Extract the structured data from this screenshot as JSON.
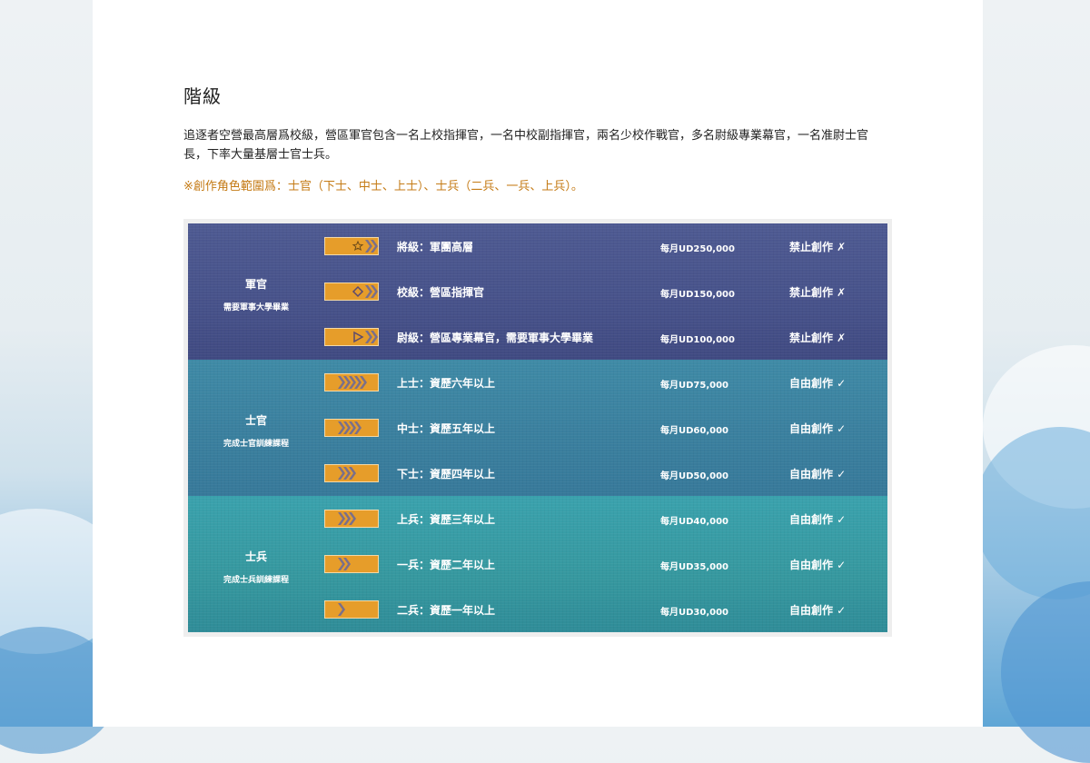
{
  "section": {
    "title": "階級",
    "intro": "追逐者空營最高層爲校級，營區軍官包含一名上校指揮官，一名中校副指揮官，兩名少校作戰官，多名尉級專業幕官，一名准尉士官長，下率大量基層士官士兵。",
    "note": "※創作角色範圍爲：士官（下士、中士、上士）、士兵（二兵、一兵、上兵）。"
  },
  "groups": [
    {
      "name": "軍官",
      "requirement": "需要軍事大學畢業",
      "rows": [
        {
          "rank": "將級：軍團高層",
          "salary": "每月UD250,000",
          "status": "禁止創作 ✗",
          "insignia": "star-insignia-icon"
        },
        {
          "rank": "校級：營區指揮官",
          "salary": "每月UD150,000",
          "status": "禁止創作 ✗",
          "insignia": "diamond-insignia-icon"
        },
        {
          "rank": "尉級：營區專業幕官，需要軍事大學畢業",
          "salary": "每月UD100,000",
          "status": "禁止創作 ✗",
          "insignia": "triangle-insignia-icon"
        }
      ]
    },
    {
      "name": "士官",
      "requirement": "完成士官訓練課程",
      "rows": [
        {
          "rank": "上士：資歷六年以上",
          "salary": "每月UD75,000",
          "status": "自由創作 ✓",
          "insignia": "chevron-5-icon"
        },
        {
          "rank": "中士：資歷五年以上",
          "salary": "每月UD60,000",
          "status": "自由創作 ✓",
          "insignia": "chevron-4-icon"
        },
        {
          "rank": "下士：資歷四年以上",
          "salary": "每月UD50,000",
          "status": "自由創作 ✓",
          "insignia": "chevron-4-icon"
        }
      ]
    },
    {
      "name": "士兵",
      "requirement": "完成士兵訓練課程",
      "rows": [
        {
          "rank": "上兵：資歷三年以上",
          "salary": "每月UD40,000",
          "status": "自由創作 ✓",
          "insignia": "chevron-3-icon"
        },
        {
          "rank": "一兵：資歷二年以上",
          "salary": "每月UD35,000",
          "status": "自由創作 ✓",
          "insignia": "chevron-2-icon"
        },
        {
          "rank": "二兵：資歷一年以上",
          "salary": "每月UD30,000",
          "status": "自由創作 ✓",
          "insignia": "chevron-1-icon"
        }
      ]
    }
  ],
  "colors": {
    "officer_band": "#47528a",
    "nco_band": "#3a7f9e",
    "soldier_band": "#36989f",
    "insignia": "#e69d2a",
    "note_text": "#c47a14"
  }
}
